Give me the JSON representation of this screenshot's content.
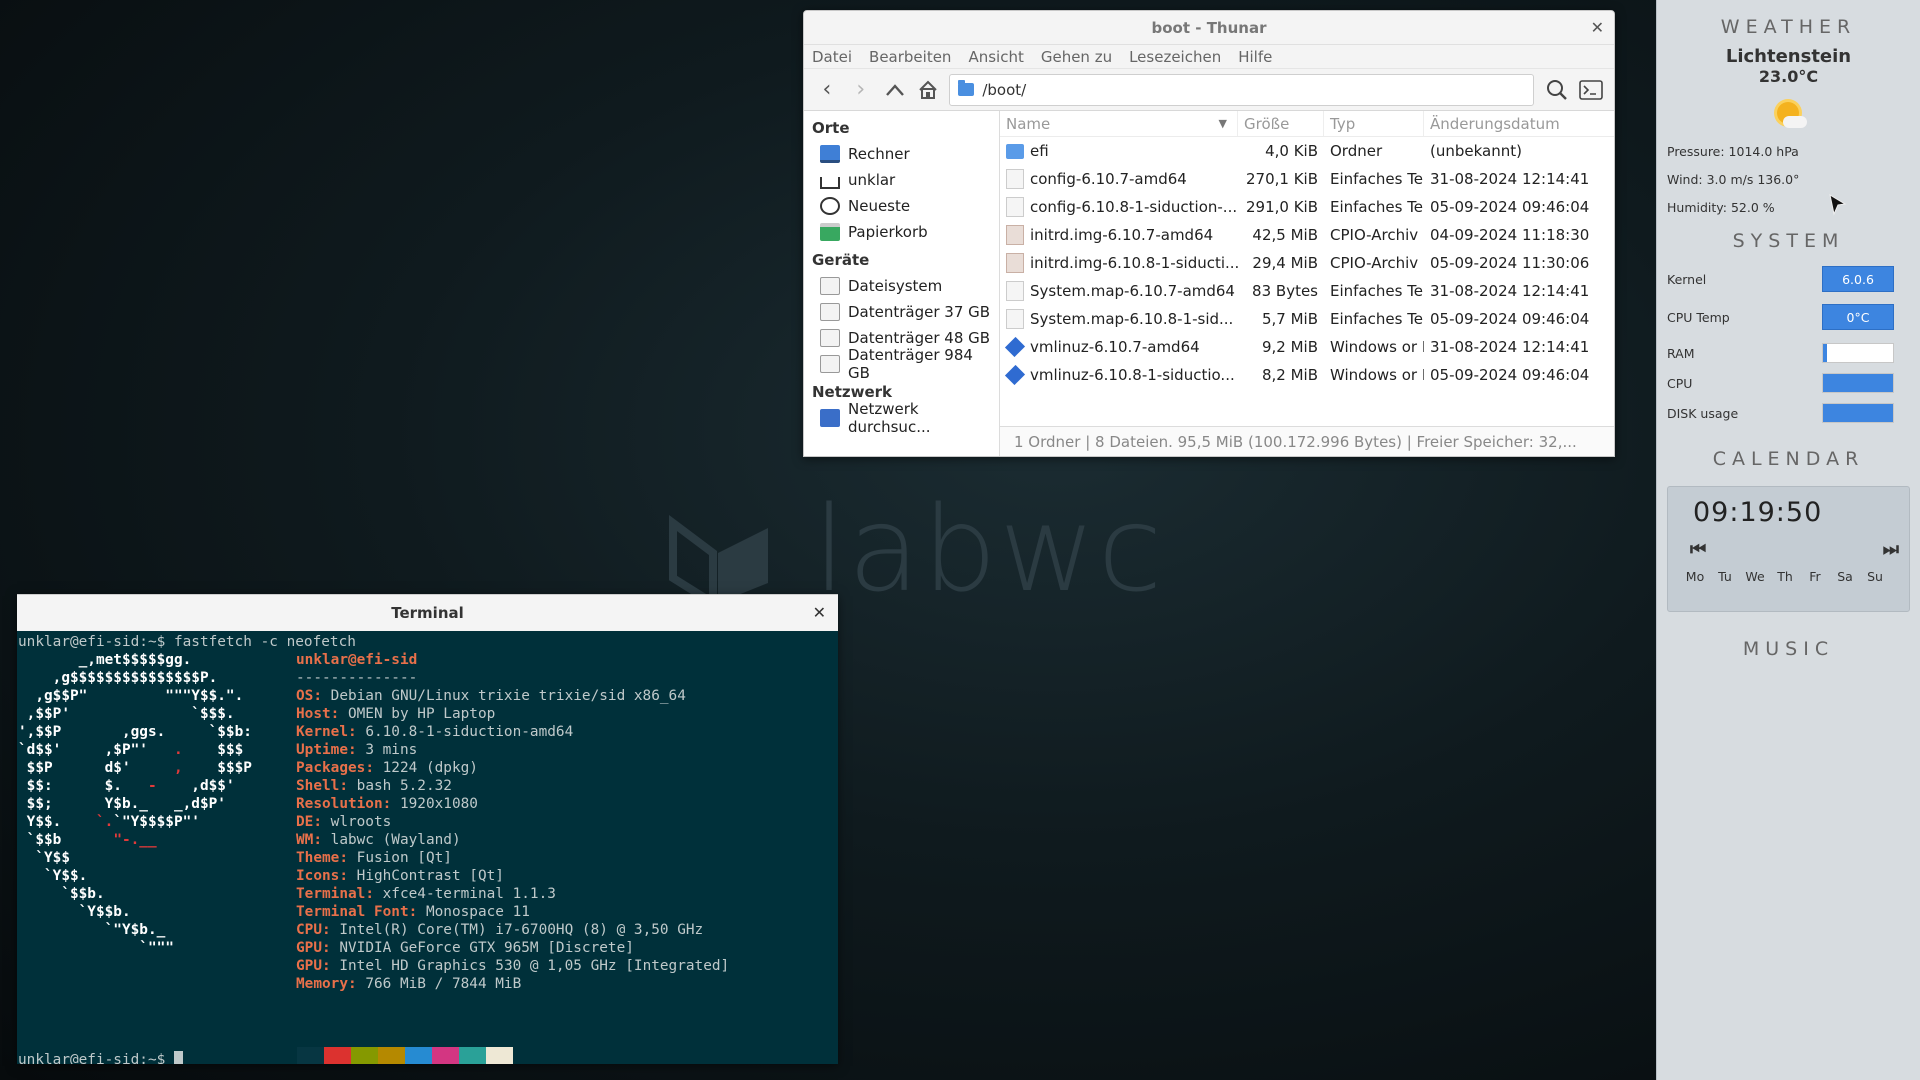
{
  "wallpaper": {
    "wordmark": "labwc"
  },
  "thunar": {
    "title": "boot - Thunar",
    "menu": [
      "Datei",
      "Bearbeiten",
      "Ansicht",
      "Gehen zu",
      "Lesezeichen",
      "Hilfe"
    ],
    "address": "/boot/",
    "sidebar": {
      "places_header": "Orte",
      "places": [
        "Rechner",
        "unklar",
        "Neueste",
        "Papierkorb"
      ],
      "devices_header": "Geräte",
      "devices": [
        "Dateisystem",
        "Datenträger 37 GB",
        "Datenträger 48 GB",
        "Datenträger 984 GB"
      ],
      "network_header": "Netzwerk",
      "network": [
        "Netzwerk durchsuc..."
      ]
    },
    "columns": {
      "name": "Name",
      "size": "Größe",
      "type": "Typ",
      "date": "Änderungsdatum"
    },
    "files": [
      {
        "name": "efi",
        "size": "4,0 KiB",
        "type": "Ordner",
        "date": "(unbekannt)",
        "icon": "folder-icon"
      },
      {
        "name": "config-6.10.7-amd64",
        "size": "270,1 KiB",
        "type": "Einfaches Te:",
        "date": "31-08-2024 12:14:41",
        "icon": "text-file-icon"
      },
      {
        "name": "config-6.10.8-1-siduction-...",
        "size": "291,0 KiB",
        "type": "Einfaches Te:",
        "date": "05-09-2024 09:46:04",
        "icon": "text-file-icon"
      },
      {
        "name": "initrd.img-6.10.7-amd64",
        "size": "42,5 MiB",
        "type": "CPIO-Archiv",
        "date": "04-09-2024 11:18:30",
        "icon": "archive-file-icon"
      },
      {
        "name": "initrd.img-6.10.8-1-siducti...",
        "size": "29,4 MiB",
        "type": "CPIO-Archiv",
        "date": "05-09-2024 11:30:06",
        "icon": "archive-file-icon"
      },
      {
        "name": "System.map-6.10.7-amd64",
        "size": "83 Bytes",
        "type": "Einfaches Te:",
        "date": "31-08-2024 12:14:41",
        "icon": "text-file-icon"
      },
      {
        "name": "System.map-6.10.8-1-sid...",
        "size": "5,7 MiB",
        "type": "Einfaches Te:",
        "date": "05-09-2024 09:46:04",
        "icon": "text-file-icon"
      },
      {
        "name": "vmlinuz-6.10.7-amd64",
        "size": "9,2 MiB",
        "type": "Windows or I",
        "date": "31-08-2024 12:14:41",
        "icon": "binary-file-icon"
      },
      {
        "name": "vmlinuz-6.10.8-1-siductio...",
        "size": "8,2 MiB",
        "type": "Windows or I",
        "date": "05-09-2024 09:46:04",
        "icon": "binary-file-icon"
      }
    ],
    "status": "1 Ordner  |  8 Dateien. 95,5 MiB (100.172.996 Bytes)  |  Freier Speicher: 32,..."
  },
  "terminal": {
    "title": "Terminal",
    "command_line": "unklar@efi-sid:~$ fastfetch -c neofetch",
    "user_host": "unklar@efi-sid",
    "separator": "--------------",
    "info": [
      {
        "label": "OS",
        "value": "Debian GNU/Linux trixie trixie/sid x86_64"
      },
      {
        "label": "Host",
        "value": "OMEN by HP Laptop"
      },
      {
        "label": "Kernel",
        "value": "6.10.8-1-siduction-amd64"
      },
      {
        "label": "Uptime",
        "value": "3 mins"
      },
      {
        "label": "Packages",
        "value": "1224 (dpkg)"
      },
      {
        "label": "Shell",
        "value": "bash 5.2.32"
      },
      {
        "label": "Resolution",
        "value": "1920x1080"
      },
      {
        "label": "DE",
        "value": "wlroots"
      },
      {
        "label": "WM",
        "value": "labwc (Wayland)"
      },
      {
        "label": "Theme",
        "value": "Fusion [Qt]"
      },
      {
        "label": "Icons",
        "value": "HighContrast [Qt]"
      },
      {
        "label": "Terminal",
        "value": "xfce4-terminal 1.1.3"
      },
      {
        "label": "Terminal Font",
        "value": "Monospace 11"
      },
      {
        "label": "CPU",
        "value": "Intel(R) Core(TM) i7-6700HQ (8) @ 3,50 GHz"
      },
      {
        "label": "GPU",
        "value": "NVIDIA GeForce GTX 965M [Discrete]"
      },
      {
        "label": "GPU",
        "value": "Intel HD Graphics 530 @ 1,05 GHz [Integrated]"
      },
      {
        "label": "Memory",
        "value": "766 MiB / 7844 MiB"
      }
    ],
    "prompt": "unklar@efi-sid:~$ ",
    "palette_top": [
      "#073642",
      "#dc322f",
      "#859900",
      "#b58900",
      "#268bd2",
      "#d33682",
      "#2aa198",
      "#eee8d5"
    ],
    "palette_bottom": [
      "#002b36",
      "#cb4b16",
      "#586e75",
      "#657b83",
      "#839496",
      "#6c71c4",
      "#93a1a1",
      "#fdf6e3"
    ]
  },
  "conky": {
    "weather_header": "WEATHER",
    "city": "Lichtenstein",
    "temperature": "23.0°C",
    "pressure": "Pressure: 1014.0 hPa",
    "wind": "Wind: 3.0 m/s 136.0°",
    "humidity": "Humidity: 52.0 %",
    "system_header": "SYSTEM",
    "kernel_label": "Kernel",
    "kernel_value": "6.0.6",
    "cputemp_label": "CPU Temp",
    "cputemp_value": "0°C",
    "ram_label": "RAM",
    "ram_fraction": 0.05,
    "cpu_label": "CPU",
    "cpu_fraction": 1.0,
    "disk_label": "DISK usage",
    "disk_fraction": 1.0,
    "calendar_header": "CALENDAR",
    "clock": "09:19:50",
    "nav_prev": "⏮",
    "nav_next": "⏭",
    "weekdays": [
      "Mo",
      "Tu",
      "We",
      "Th",
      "Fr",
      "Sa",
      "Su"
    ],
    "music_header": "MUSIC"
  }
}
